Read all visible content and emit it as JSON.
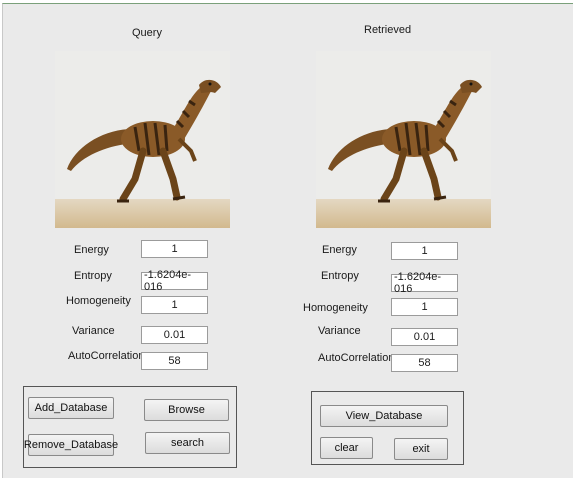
{
  "query": {
    "title": "Query",
    "image_alt": "dinosaur",
    "features": [
      {
        "label": "Energy",
        "value": "1"
      },
      {
        "label": "Entropy",
        "value": "-1.6204e-016"
      },
      {
        "label": "Homogeneity",
        "value": "1"
      },
      {
        "label": "Variance",
        "value": "0.01"
      },
      {
        "label": "AutoCorrelation",
        "value": "58"
      }
    ]
  },
  "retrieved": {
    "title": "Retrieved",
    "image_alt": "dinosaur",
    "features": [
      {
        "label": "Energy",
        "value": "1"
      },
      {
        "label": "Entropy",
        "value": "-1.6204e-016"
      },
      {
        "label": "Homogeneity",
        "value": "1"
      },
      {
        "label": "Variance",
        "value": "0.01"
      },
      {
        "label": "AutoCorrelation",
        "value": "58"
      }
    ]
  },
  "left_panel": {
    "add_database": "Add_Database",
    "browse": "Browse",
    "remove_database": "Remove_Database",
    "search": "search"
  },
  "right_panel": {
    "view_database": "View_Database",
    "clear": "clear",
    "exit": "exit"
  },
  "colors": {
    "window_bg": "#eaeaea",
    "field_bg": "#ffffff",
    "panel_border": "#555555",
    "frame_accent": "#7aa07a"
  }
}
